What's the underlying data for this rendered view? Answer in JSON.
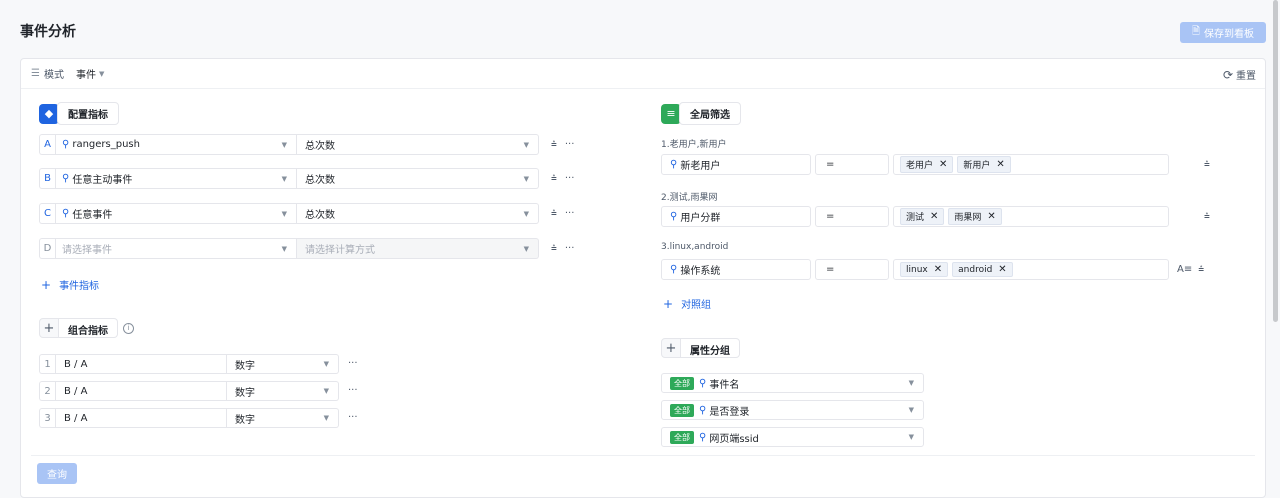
{
  "header": {
    "title": "事件分析",
    "save_label": "保存到看板"
  },
  "mode_bar": {
    "mode_label": "模式",
    "mode_value": "事件",
    "reset_label": "重置"
  },
  "metrics": {
    "title": "配置指标",
    "rows": [
      {
        "letter": "A",
        "event": "rangers_push",
        "calc": "总次数",
        "placeholder": false
      },
      {
        "letter": "B",
        "event": "任意主动事件",
        "calc": "总次数",
        "placeholder": false
      },
      {
        "letter": "C",
        "event": "任意事件",
        "calc": "总次数",
        "placeholder": false
      },
      {
        "letter": "D",
        "event": "请选择事件",
        "calc": "请选择计算方式",
        "placeholder": true
      }
    ],
    "add_label": "事件指标"
  },
  "combo": {
    "title": "组合指标",
    "rows": [
      {
        "num": "1",
        "expr": "B / A",
        "type": "数字"
      },
      {
        "num": "2",
        "expr": "B / A",
        "type": "数字"
      },
      {
        "num": "3",
        "expr": "B / A",
        "type": "数字"
      }
    ]
  },
  "filters": {
    "title": "全局筛选",
    "groups": [
      {
        "label": "1.老用户,新用户",
        "property": "新老用户",
        "op": "=",
        "values": [
          "老用户",
          "新用户"
        ]
      },
      {
        "label": "2.测试,雨果网",
        "property": "用户分群",
        "op": "=",
        "values": [
          "测试",
          "雨果网"
        ]
      },
      {
        "label": "3.linux,android",
        "property": "操作系统",
        "op": "=",
        "values": [
          "linux",
          "android"
        ]
      }
    ],
    "add_label": "对照组"
  },
  "grouping": {
    "title": "属性分组",
    "rows": [
      {
        "badge": "全部",
        "name": "事件名"
      },
      {
        "badge": "全部",
        "name": "是否登录"
      },
      {
        "badge": "全部",
        "name": "网页端ssid"
      }
    ]
  },
  "query_label": "查询",
  "colors": {
    "accent": "#1f64e0",
    "green": "#2ea959",
    "disabled_btn": "#a9c4f5"
  }
}
